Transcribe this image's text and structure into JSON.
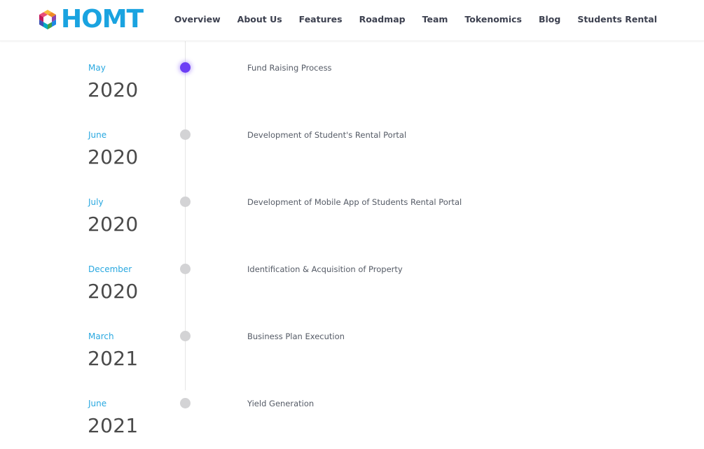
{
  "header": {
    "logo_text": "HOMT",
    "nav": [
      {
        "label": "Overview"
      },
      {
        "label": "About Us"
      },
      {
        "label": "Features"
      },
      {
        "label": "Roadmap"
      },
      {
        "label": "Team"
      },
      {
        "label": "Tokenomics"
      },
      {
        "label": "Blog"
      },
      {
        "label": "Students Rental"
      }
    ]
  },
  "roadmap": {
    "items": [
      {
        "month": "May",
        "year": "2020",
        "description": "Fund Raising Process",
        "active": true
      },
      {
        "month": "June",
        "year": "2020",
        "description": "Development of Student's Rental Portal",
        "active": false
      },
      {
        "month": "July",
        "year": "2020",
        "description": "Development of Mobile App of Students Rental Portal",
        "active": false
      },
      {
        "month": "December",
        "year": "2020",
        "description": "Identification & Acquisition of Property",
        "active": false
      },
      {
        "month": "March",
        "year": "2021",
        "description": "Business Plan Execution",
        "active": false
      },
      {
        "month": "June",
        "year": "2021",
        "description": "Yield Generation",
        "active": false
      }
    ]
  },
  "colors": {
    "brand_blue": "#1aa3e0",
    "month_blue": "#29a8e0",
    "active_dot": "#6c3df5",
    "inactive_dot": "#d3d3d5"
  }
}
